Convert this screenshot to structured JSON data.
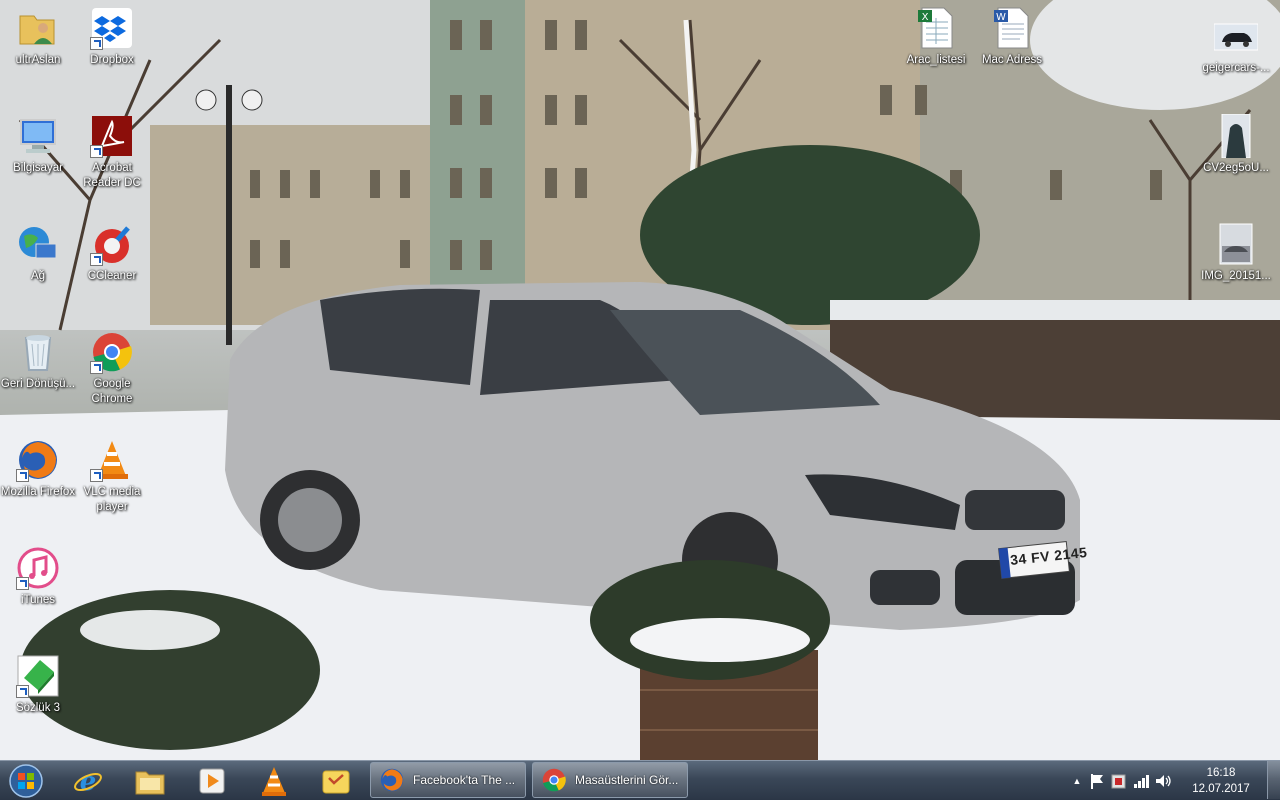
{
  "desktop": {
    "icons": [
      {
        "label": "ultrAslan"
      },
      {
        "label": "Dropbox"
      },
      {
        "label": "Bilgisayar"
      },
      {
        "label": "Acrobat Reader DC"
      },
      {
        "label": "Ağ"
      },
      {
        "label": "CCleaner"
      },
      {
        "label": "Geri Dönüşü..."
      },
      {
        "label": "Google Chrome"
      },
      {
        "label": "Mozilla Firefox"
      },
      {
        "label": "VLC media player"
      },
      {
        "label": "iTunes"
      },
      {
        "label": "Sözlük 3"
      },
      {
        "label": "Arac_listesi"
      },
      {
        "label": "Mac Adress"
      },
      {
        "label": "geigercars-..."
      },
      {
        "label": "CV2eg5oU..."
      },
      {
        "label": "IMG_20151..."
      }
    ],
    "plate_text": "34 FV 2145"
  },
  "taskbar": {
    "pinned": [
      "start-orb",
      "internet-explorer",
      "explorer",
      "media-player",
      "vlc",
      "outlook-notes"
    ],
    "tasks": [
      {
        "label": "Facebook'ta The ..."
      },
      {
        "label": "Masaüstlerini Gör..."
      }
    ],
    "clock": {
      "time": "16:18",
      "date": "12.07.2017"
    }
  },
  "colors": {
    "taskbar": "#3a4758",
    "accent": "#1f5fbf"
  }
}
